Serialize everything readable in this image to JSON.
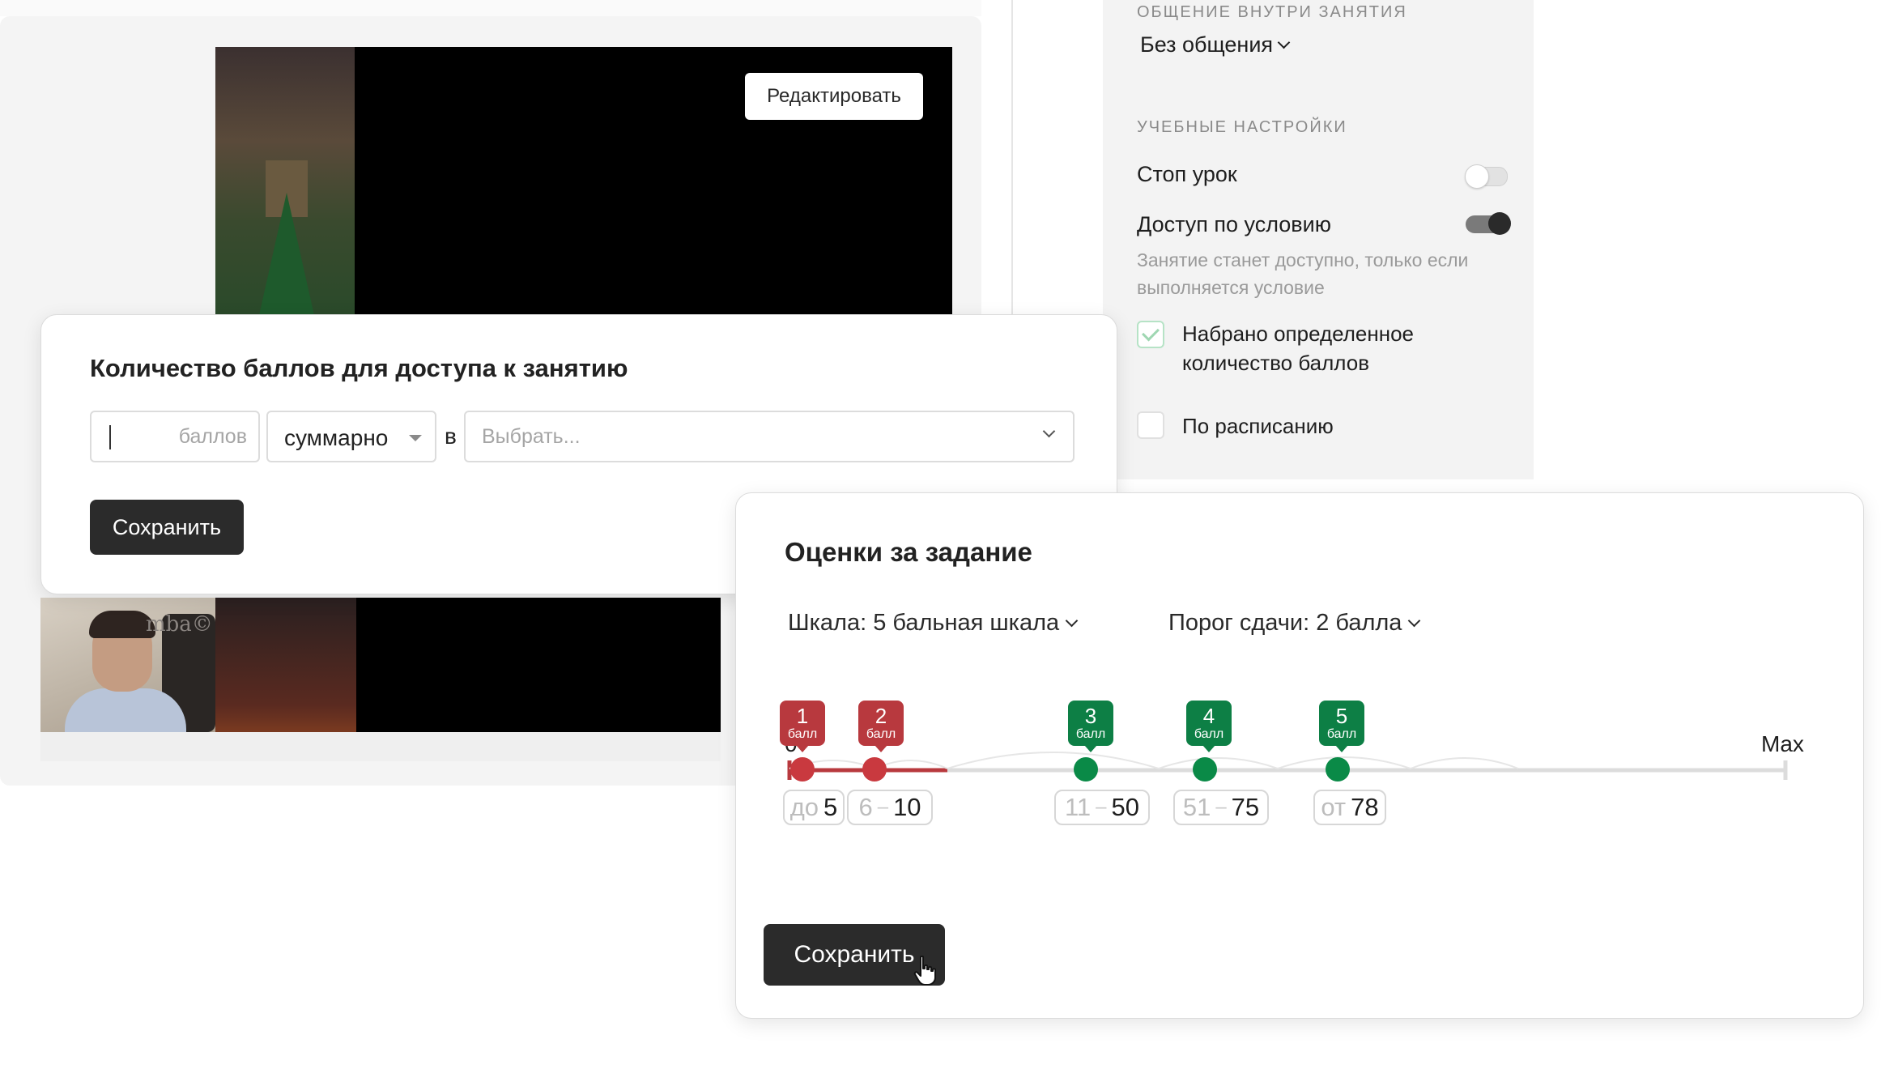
{
  "video_editor": {
    "edit_button": "Редактировать",
    "watermark": "mba©"
  },
  "settings": {
    "communication_section": "ОБЩЕНИЕ ВНУТРИ ЗАНЯТИЯ",
    "communication_value": "Без общения",
    "learning_section": "УЧЕБНЫЕ НАСТРОЙКИ",
    "stop_lesson": {
      "label": "Стоп урок",
      "enabled": false
    },
    "conditional_access": {
      "label": "Доступ по условию",
      "enabled": true
    },
    "conditional_hint": "Занятие станет доступно, только если выполняется условие",
    "option_points": {
      "label_line1": "Набрано определенное",
      "label_line2": "количество баллов",
      "checked": true
    },
    "option_schedule": {
      "label": "По расписанию",
      "checked": false
    }
  },
  "points_card": {
    "title": "Количество баллов для доступа к занятию",
    "points_placeholder": "баллов",
    "aggregate_value": "суммарно",
    "preposition": "в",
    "target_placeholder": "Выбрать...",
    "save_label": "Сохранить"
  },
  "grades_card": {
    "title": "Оценки за задание",
    "scale_filter": "Шкала: 5 бальная шкала",
    "threshold_filter": "Порог сдачи: 2 балла",
    "axis_start": "0",
    "axis_end": "Max",
    "unit": "балл",
    "colors": {
      "fail": "#b8393e",
      "pass": "#0d7f45"
    },
    "grades": [
      {
        "grade": "1",
        "status": "fail",
        "from": "до",
        "to": "5"
      },
      {
        "grade": "2",
        "status": "fail",
        "from": "6",
        "to": "10"
      },
      {
        "grade": "3",
        "status": "pass",
        "from": "11",
        "to": "50"
      },
      {
        "grade": "4",
        "status": "pass",
        "from": "51",
        "to": "75"
      },
      {
        "grade": "5",
        "status": "pass",
        "from": "от",
        "to": "78"
      }
    ],
    "save_label": "Сохранить"
  }
}
